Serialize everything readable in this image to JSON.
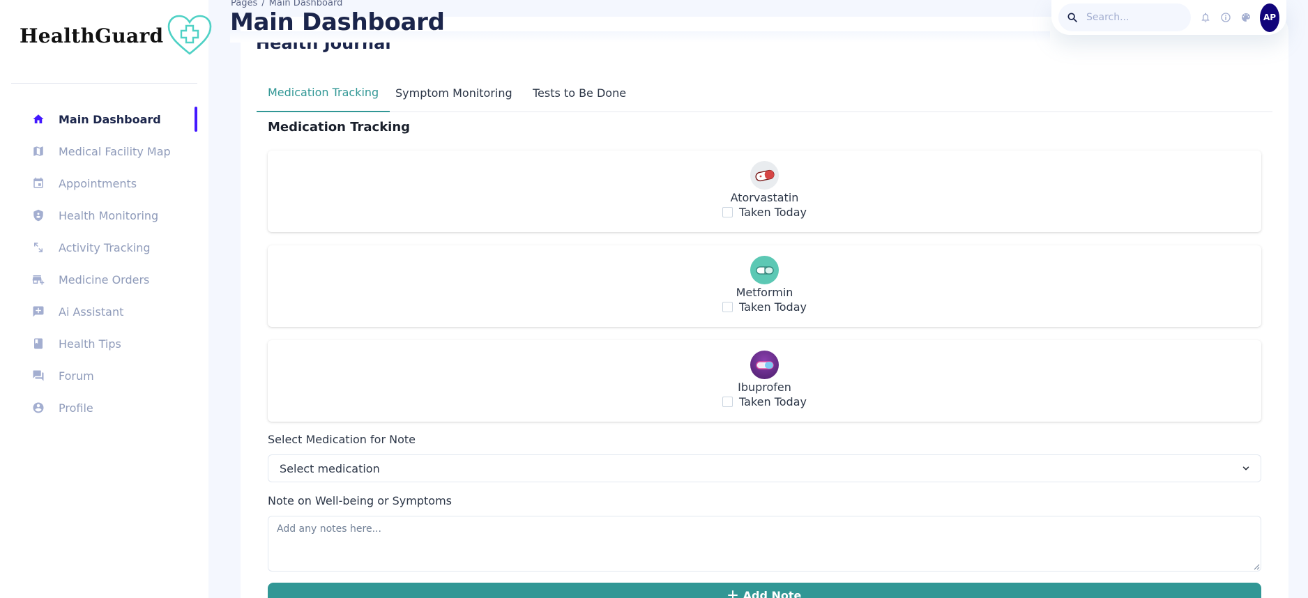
{
  "brand": {
    "name": "HealthGuard",
    "logo_icon": "heart-plus-logo",
    "accent": "#4fd1c5"
  },
  "sidebar": {
    "items": [
      {
        "label": "Main Dashboard",
        "icon": "home-icon",
        "active": true
      },
      {
        "label": "Medical Facility Map",
        "icon": "map-icon"
      },
      {
        "label": "Appointments",
        "icon": "calendar-icon"
      },
      {
        "label": "Health Monitoring",
        "icon": "shield-icon"
      },
      {
        "label": "Activity Tracking",
        "icon": "arrows-diagonal-icon"
      },
      {
        "label": "Medicine Orders",
        "icon": "add-business-icon"
      },
      {
        "label": "Ai Assistant",
        "icon": "chat-plus-icon"
      },
      {
        "label": "Health Tips",
        "icon": "book-icon"
      },
      {
        "label": "Forum",
        "icon": "forum-icon"
      },
      {
        "label": "Profile",
        "icon": "account-circle-icon"
      }
    ]
  },
  "header": {
    "breadcrumb": {
      "root": "Pages",
      "separator": "/",
      "current": "Main Dashboard"
    },
    "title": "Main Dashboard",
    "search_placeholder": "Search...",
    "avatar_initials": "AP",
    "icons": [
      "bell-icon",
      "info-icon",
      "palette-icon"
    ]
  },
  "card": {
    "title": "Health Journal",
    "tabs": [
      {
        "label": "Medication Tracking",
        "active": true
      },
      {
        "label": "Symptom Monitoring"
      },
      {
        "label": "Tests to Be Done"
      }
    ],
    "section_heading": "Medication Tracking",
    "medications": [
      {
        "name": "Atorvastatin",
        "checkbox_label": "Taken Today",
        "checked": false,
        "icon": "pill-red-icon",
        "icon_bg": "#e9ecef"
      },
      {
        "name": "Metformin",
        "checkbox_label": "Taken Today",
        "checked": false,
        "icon": "pill-teal-icon",
        "icon_bg": "#5cc8b4"
      },
      {
        "name": "Ibuprofen",
        "checkbox_label": "Taken Today",
        "checked": false,
        "icon": "pill-purple-icon",
        "icon_bg": "#6b2f86"
      }
    ],
    "select_label": "Select Medication for Note",
    "select_value": "Select medication",
    "note_label": "Note on Well-being or Symptoms",
    "note_placeholder": "Add any notes here...",
    "add_button_label": "Add Note"
  },
  "colors": {
    "primary": "#4318ff",
    "teal": "#319795",
    "avatar_bg": "#11047a",
    "text_dark": "#1b254b",
    "text_muted": "#8f9bba"
  }
}
